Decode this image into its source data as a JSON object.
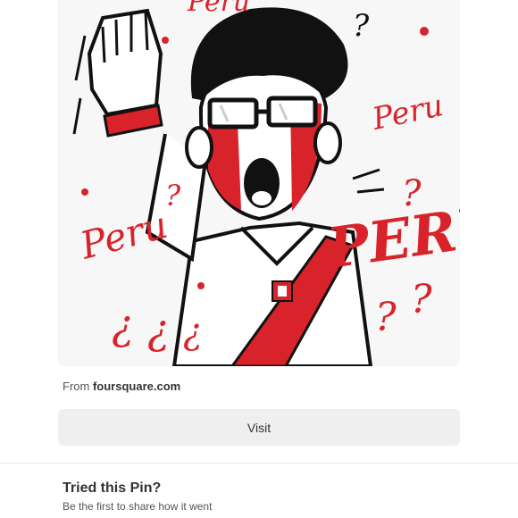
{
  "pin": {
    "image_description_icon": "cartoon-illustration",
    "colors": {
      "ink": "#111111",
      "red": "#d8232a",
      "background": "#f7f7f7"
    },
    "source_prefix": "From",
    "source_domain": "foursquare.com",
    "visit_label": "Visit"
  },
  "tried": {
    "title": "Tried this Pin?",
    "subtitle": "Be the first to share how it went"
  }
}
